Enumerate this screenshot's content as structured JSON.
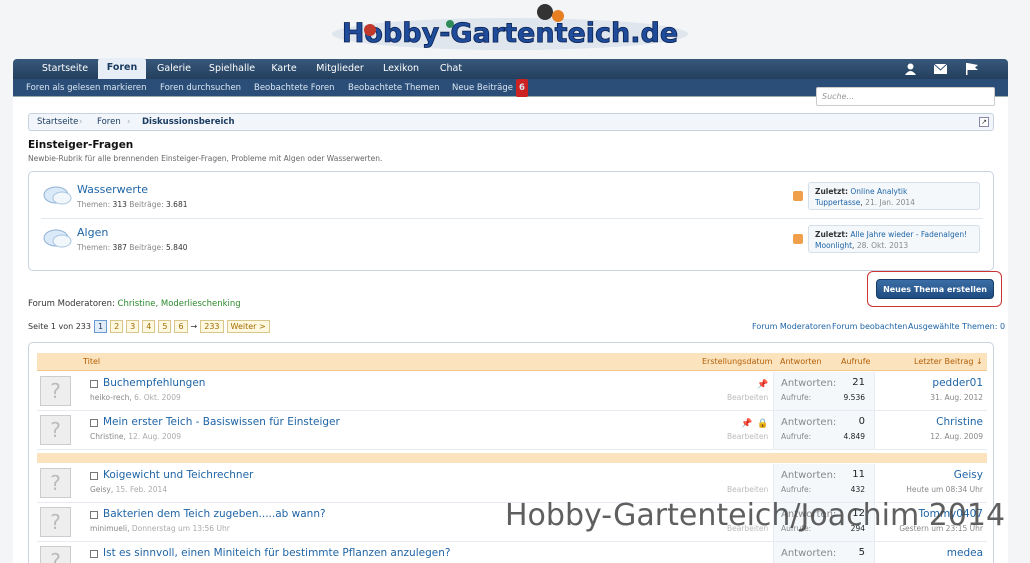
{
  "logo": {
    "text": "Hobby-Gartenteich.de"
  },
  "nav": {
    "tabs": [
      "Startseite",
      "Foren",
      "Galerie",
      "Spielhalle",
      "Karte",
      "Mitglieder",
      "Lexikon",
      "Chat"
    ],
    "active": "Foren"
  },
  "subnav": {
    "links": [
      "Foren als gelesen markieren",
      "Foren durchsuchen",
      "Beobachtete Foren",
      "Beobachtete Themen",
      "Neue Beiträge"
    ],
    "new_count": "6"
  },
  "search": {
    "placeholder": "Suche..."
  },
  "breadcrumb": [
    "Startseite",
    "Foren",
    "Diskussionsbereich"
  ],
  "page": {
    "title": "Einsteiger-Fragen",
    "description": "Newbie-Rubrik für alle brennenden Einsteiger-Fragen, Probleme mit Algen oder Wasserwerten."
  },
  "forums": [
    {
      "name": "Wasserwerte",
      "themes_label": "Themen:",
      "themes": "313",
      "posts_label": "Beiträge:",
      "posts": "3.681",
      "last_label": "Zuletzt:",
      "last_title": "Online Analytik",
      "last_user": "Tuppertasse",
      "last_date": "21. Jan. 2014"
    },
    {
      "name": "Algen",
      "themes_label": "Themen:",
      "themes": "387",
      "posts_label": "Beiträge:",
      "posts": "5.840",
      "last_label": "Zuletzt:",
      "last_title": "Alle Jahre wieder - Fadenalgen!",
      "last_user": "Moonlight",
      "last_date": "28. Okt. 2013"
    }
  ],
  "new_thread_button": "Neues Thema erstellen",
  "moderators": {
    "label": "Forum Moderatoren:",
    "names": "Christine, Moderlieschenking"
  },
  "pager": {
    "label": "Seite 1 von 233",
    "pages": [
      "1",
      "2",
      "3",
      "4",
      "5",
      "6"
    ],
    "ellipsis": "→",
    "last": "233",
    "next": "Weiter >"
  },
  "actions": [
    "Forum Moderatoren",
    "Forum beobachten",
    "Ausgewählte Themen: 0"
  ],
  "table_header": {
    "title": "Titel",
    "created": "Erstellungsdatum",
    "replies": "Antworten",
    "views": "Aufrufe",
    "last": "Letzter Beitrag ↓"
  },
  "threads": [
    {
      "title": "Buchempfehlungen",
      "author": "heiko-rech",
      "date": "6. Okt. 2009",
      "edit": "Bearbeiten",
      "replies_label": "Antworten:",
      "replies": "21",
      "views_label": "Aufrufe:",
      "views": "9.536",
      "last_user": "pedder01",
      "last_date": "31. Aug. 2012",
      "sticky": true,
      "locked": false
    },
    {
      "title": "Mein erster Teich - Basiswissen für Einsteiger",
      "author": "Christine",
      "date": "12. Aug. 2009",
      "edit": "Bearbeiten",
      "replies_label": "Antworten:",
      "replies": "0",
      "views_label": "Aufrufe:",
      "views": "4.849",
      "last_user": "Christine",
      "last_date": "12. Aug. 2009",
      "sticky": true,
      "locked": true
    },
    {
      "title": "Koigewicht und Teichrechner",
      "author": "Geisy",
      "date": "15. Feb. 2014",
      "edit": "Bearbeiten",
      "replies_label": "Antworten:",
      "replies": "11",
      "views_label": "Aufrufe:",
      "views": "432",
      "last_user": "Geisy",
      "last_date": "Heute um 08:34 Uhr",
      "sticky": false,
      "locked": false
    },
    {
      "title": "Bakterien dem Teich zugeben.....ab wann?",
      "author": "minimueli",
      "date": "Donnerstag um 13:56 Uhr",
      "edit": "Bearbeiten",
      "replies_label": "Antworten:",
      "replies": "12",
      "views_label": "Aufrufe:",
      "views": "294",
      "last_user": "Tommy0407",
      "last_date": "Gestern um 23:15 Uhr",
      "sticky": false,
      "locked": false
    },
    {
      "title": "Ist es sinnvoll, einen Miniteich für bestimmte Pflanzen anzulegen?",
      "author": "",
      "date": "",
      "edit": "",
      "replies_label": "Antworten:",
      "replies": "5",
      "views_label": "",
      "views": "",
      "last_user": "medea",
      "last_date": "",
      "sticky": false,
      "locked": false
    }
  ],
  "watermark": "Hobby-Gartenteich/Joachim 2014"
}
